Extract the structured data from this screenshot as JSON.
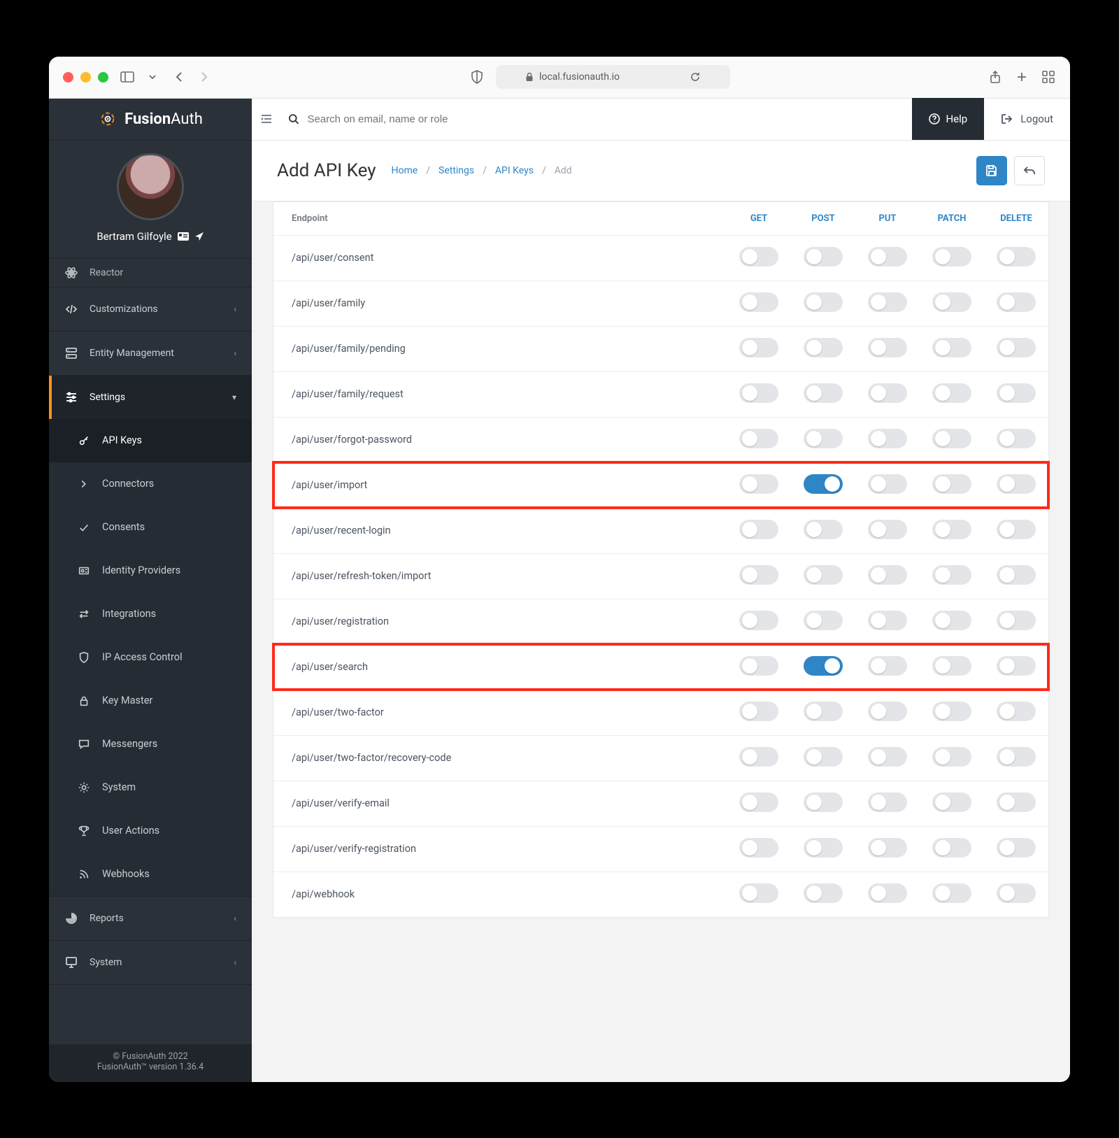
{
  "browser": {
    "url_host": "local.fusionauth.io"
  },
  "brand": {
    "name_a": "Fusion",
    "name_b": "Auth"
  },
  "profile": {
    "name": "Bertram Gilfoyle"
  },
  "topbar": {
    "search_placeholder": "Search on email, name or role",
    "help": "Help",
    "logout": "Logout"
  },
  "page": {
    "title": "Add API Key",
    "breadcrumbs": [
      "Home",
      "Settings",
      "API Keys",
      "Add"
    ]
  },
  "footer": {
    "line1": "© FusionAuth 2022",
    "line2": "FusionAuth™ version 1.36.4"
  },
  "sidebar": {
    "top": [
      {
        "icon": "atom",
        "label": "Reactor",
        "cut": true
      },
      {
        "icon": "code",
        "label": "Customizations",
        "expandable": true
      },
      {
        "icon": "server",
        "label": "Entity Management",
        "expandable": true
      }
    ],
    "settings_label": "Settings",
    "settings_children": [
      {
        "icon": "key",
        "label": "API Keys",
        "active": true
      },
      {
        "icon": "chev-right",
        "label": "Connectors"
      },
      {
        "icon": "check",
        "label": "Consents"
      },
      {
        "icon": "idp",
        "label": "Identity Providers"
      },
      {
        "icon": "swap",
        "label": "Integrations"
      },
      {
        "icon": "shield",
        "label": "IP Access Control"
      },
      {
        "icon": "lock",
        "label": "Key Master"
      },
      {
        "icon": "chat",
        "label": "Messengers"
      },
      {
        "icon": "gear",
        "label": "System"
      },
      {
        "icon": "trophy",
        "label": "User Actions"
      },
      {
        "icon": "rss",
        "label": "Webhooks"
      }
    ],
    "bottom": [
      {
        "icon": "pie",
        "label": "Reports",
        "expandable": true
      },
      {
        "icon": "monitor",
        "label": "System",
        "expandable": true
      }
    ]
  },
  "table": {
    "col_endpoint": "Endpoint",
    "methods": [
      "GET",
      "POST",
      "PUT",
      "PATCH",
      "DELETE"
    ],
    "rows": [
      {
        "endpoint": "/api/user/consent",
        "on": [],
        "hl": false
      },
      {
        "endpoint": "/api/user/family",
        "on": [],
        "hl": false
      },
      {
        "endpoint": "/api/user/family/pending",
        "on": [],
        "hl": false
      },
      {
        "endpoint": "/api/user/family/request",
        "on": [],
        "hl": false
      },
      {
        "endpoint": "/api/user/forgot-password",
        "on": [],
        "hl": false
      },
      {
        "endpoint": "/api/user/import",
        "on": [
          "POST"
        ],
        "hl": true
      },
      {
        "endpoint": "/api/user/recent-login",
        "on": [],
        "hl": false
      },
      {
        "endpoint": "/api/user/refresh-token/import",
        "on": [],
        "hl": false
      },
      {
        "endpoint": "/api/user/registration",
        "on": [],
        "hl": false
      },
      {
        "endpoint": "/api/user/search",
        "on": [
          "POST"
        ],
        "hl": true
      },
      {
        "endpoint": "/api/user/two-factor",
        "on": [],
        "hl": false
      },
      {
        "endpoint": "/api/user/two-factor/recovery-code",
        "on": [],
        "hl": false
      },
      {
        "endpoint": "/api/user/verify-email",
        "on": [],
        "hl": false
      },
      {
        "endpoint": "/api/user/verify-registration",
        "on": [],
        "hl": false
      },
      {
        "endpoint": "/api/webhook",
        "on": [],
        "hl": false
      }
    ]
  }
}
